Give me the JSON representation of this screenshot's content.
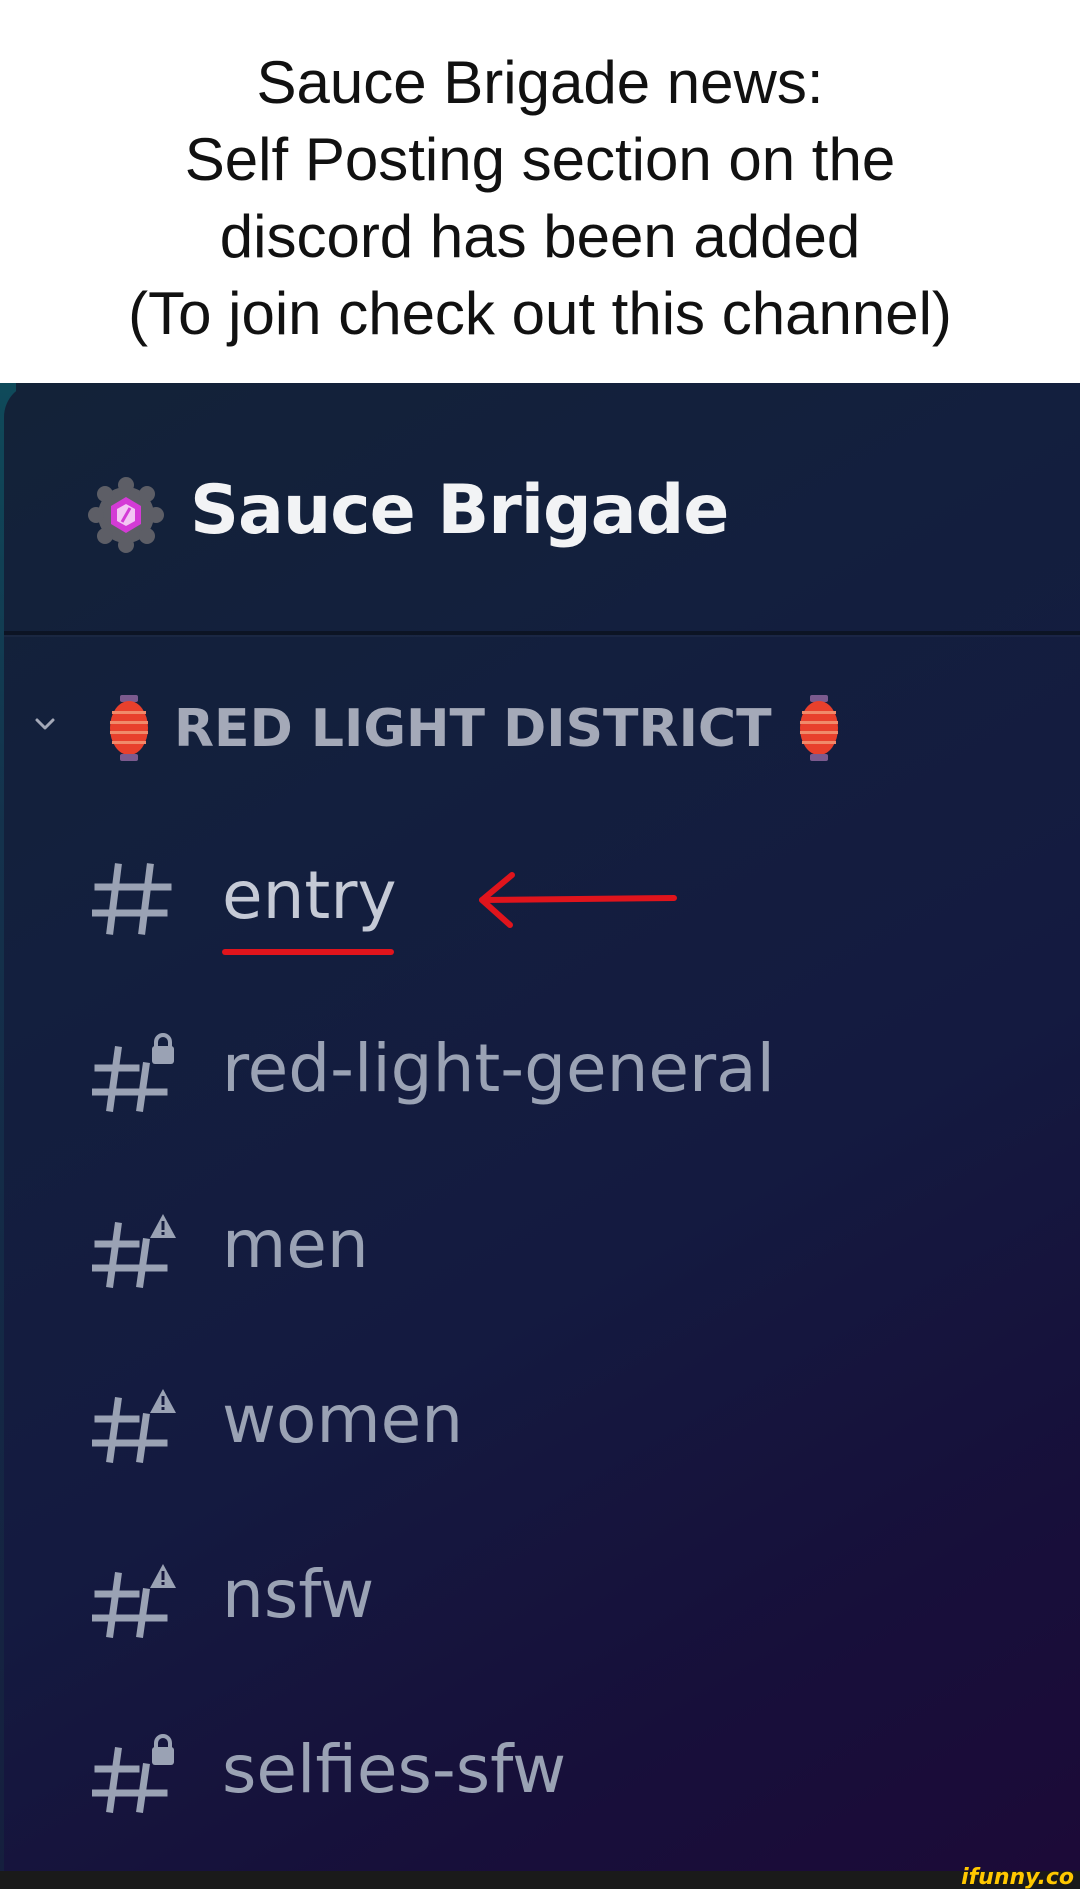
{
  "caption": {
    "lines": [
      "Sauce Brigade news:",
      "Self Posting section on the",
      "discord has been added",
      "(To join check out this channel)"
    ]
  },
  "server": {
    "name": "Sauce Brigade",
    "icon": "server-hexagon-icon"
  },
  "category": {
    "label": "RED LIGHT DISTRICT",
    "left_icon": "red-lantern-icon",
    "right_icon": "red-lantern-icon",
    "collapse_icon": "chevron-down-icon"
  },
  "channels": [
    {
      "name": "entry",
      "icon": "hashtag-icon",
      "locked": false,
      "highlighted": true
    },
    {
      "name": "red-light-general",
      "icon": "hashtag-lock-icon",
      "locked": true
    },
    {
      "name": "men",
      "icon": "hashtag-warning-icon",
      "locked": true
    },
    {
      "name": "women",
      "icon": "hashtag-warning-icon",
      "locked": true
    },
    {
      "name": "nsfw",
      "icon": "hashtag-warning-icon",
      "locked": true
    },
    {
      "name": "selfies-sfw",
      "icon": "hashtag-lock-icon",
      "locked": true
    }
  ],
  "annotation": {
    "color": "#e0141c",
    "arrow_icon": "red-arrow-left-icon"
  },
  "watermark": "ifunny.co"
}
